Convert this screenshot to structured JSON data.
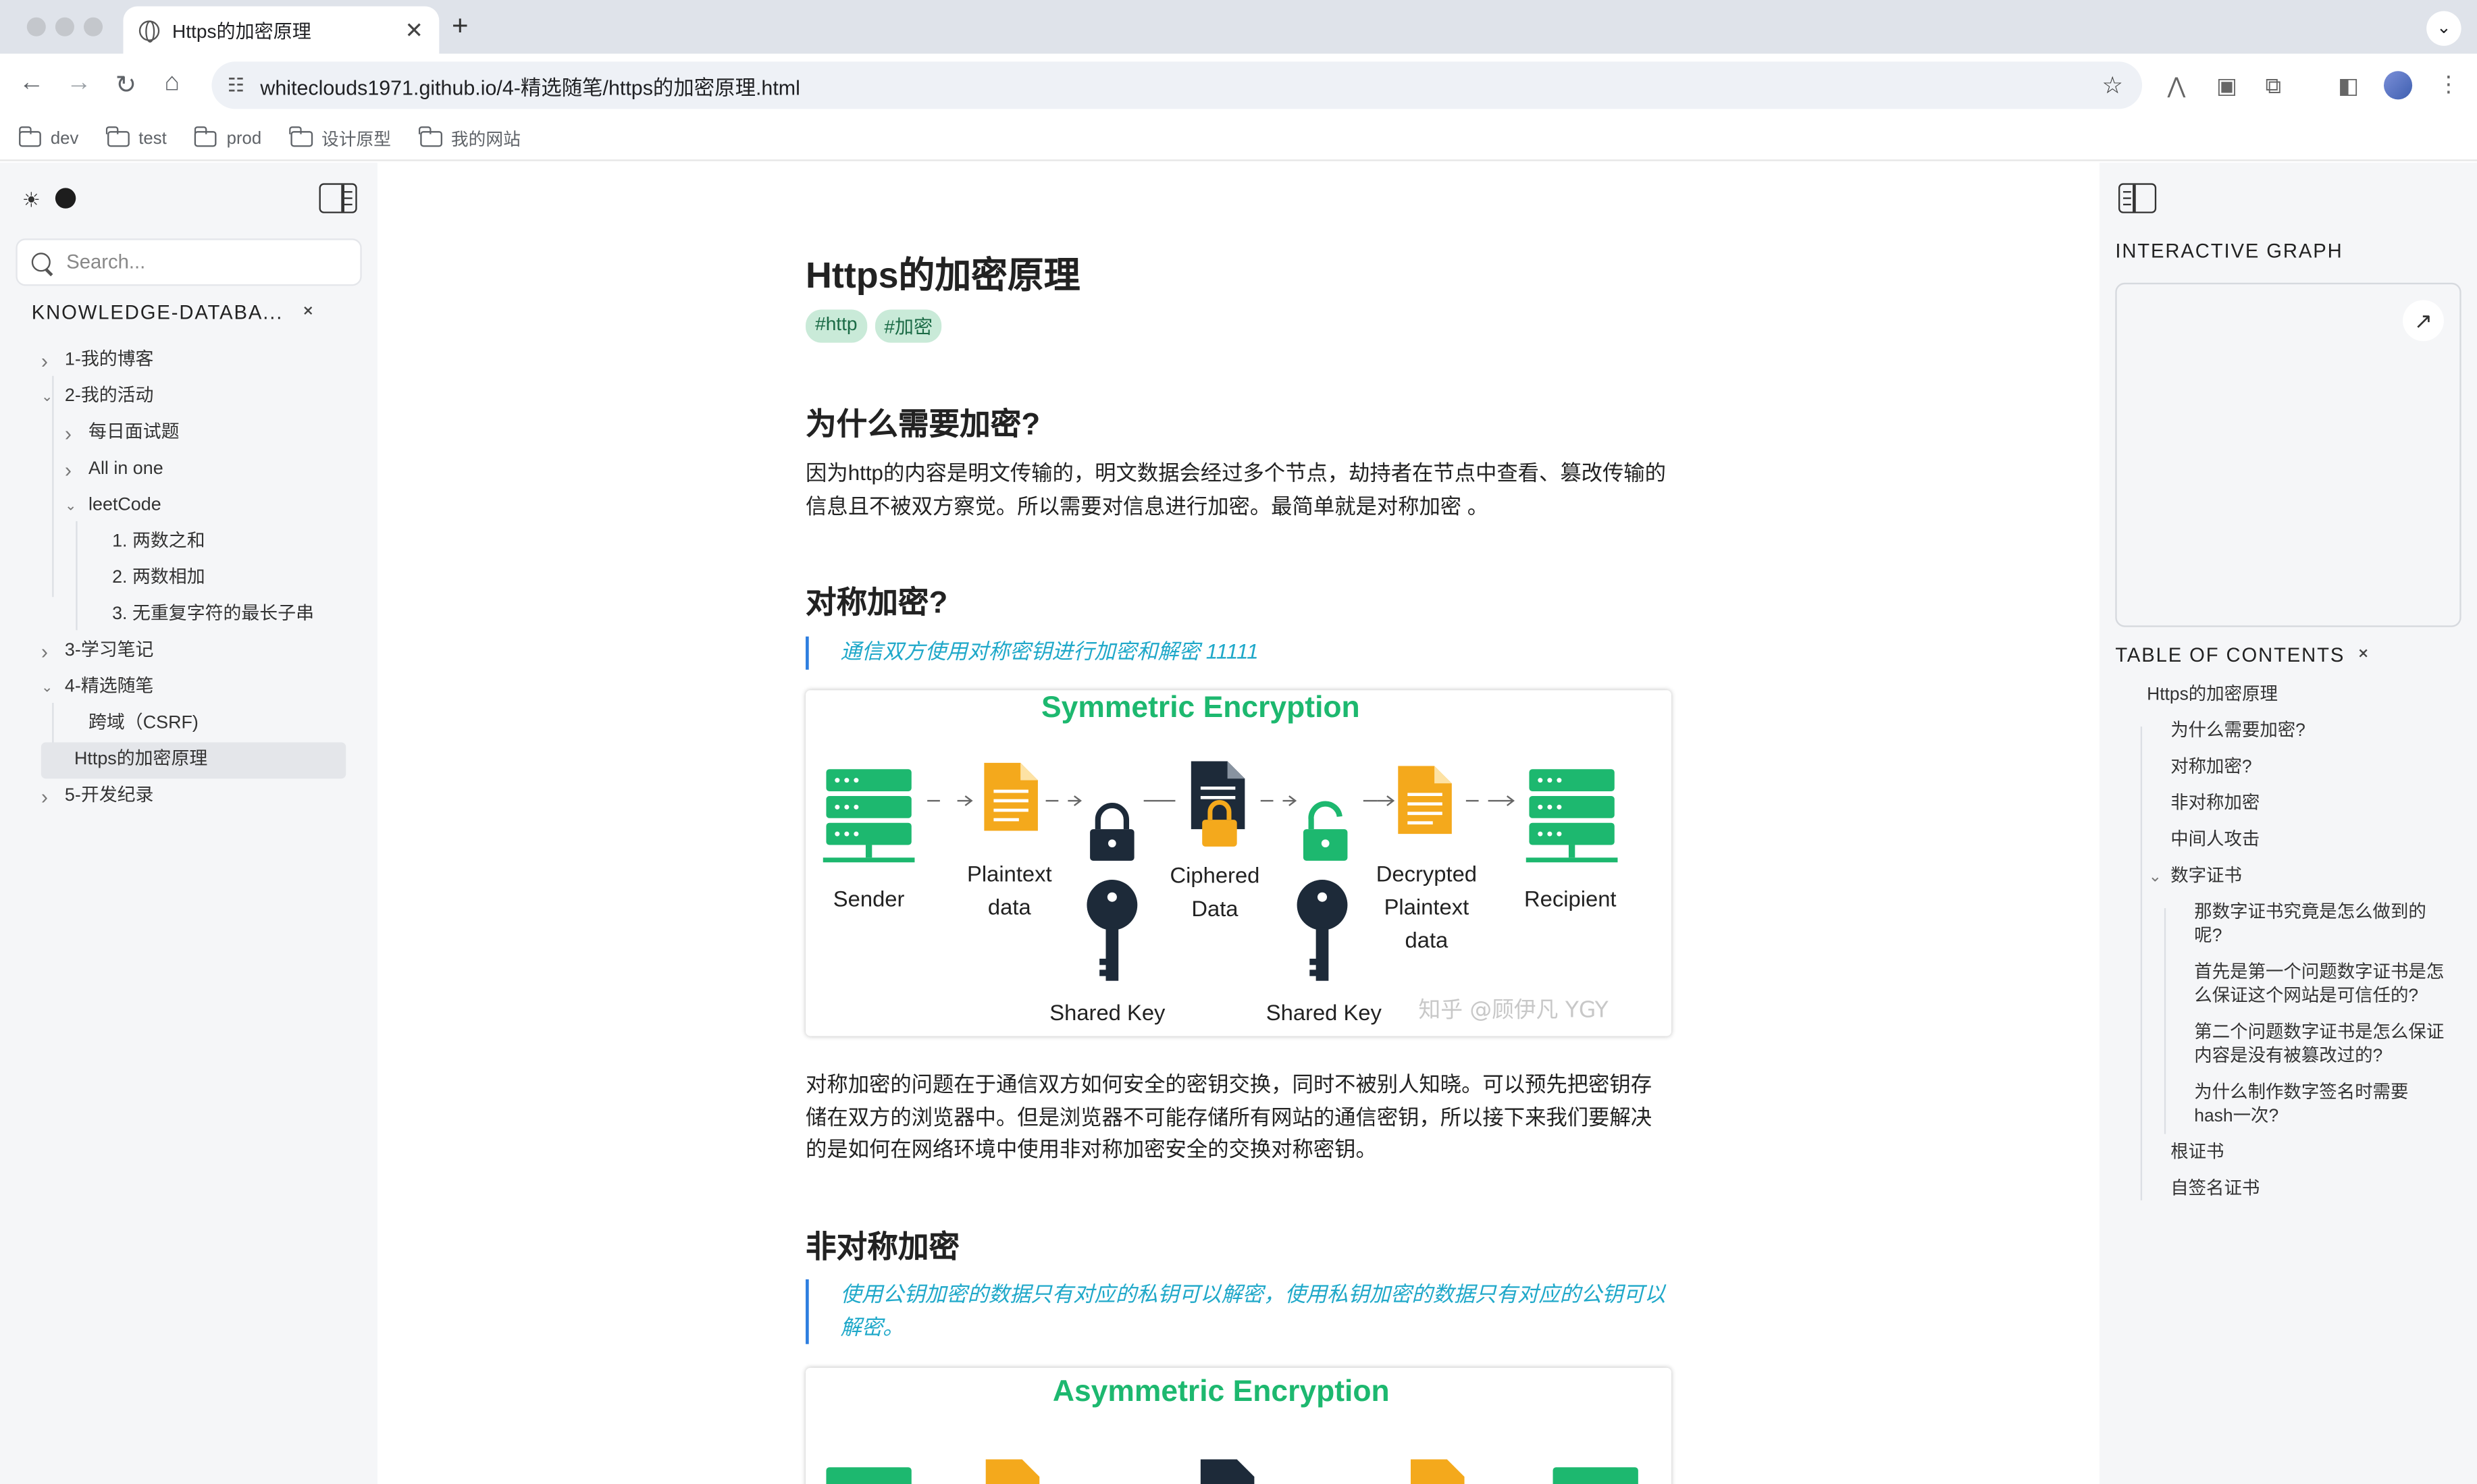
{
  "browser": {
    "tab_title": "Https的加密原理",
    "url": "whiteclouds1971.github.io/4-精选随笔/https的加密原理.html",
    "bookmarks": [
      "dev",
      "test",
      "prod",
      "设计原型",
      "我的网站"
    ]
  },
  "sidebar": {
    "search_placeholder": "Search...",
    "root_title": "KNOWLEDGE-DATABA...",
    "tree": [
      {
        "label": "1-我的博客",
        "level": 0,
        "expanded": false
      },
      {
        "label": "2-我的活动",
        "level": 0,
        "expanded": true
      },
      {
        "label": "每日面试题",
        "level": 1,
        "expanded": false
      },
      {
        "label": "All in one",
        "level": 1,
        "expanded": false
      },
      {
        "label": "leetCode",
        "level": 1,
        "expanded": true
      },
      {
        "label": "1. 两数之和",
        "level": 2
      },
      {
        "label": "2. 两数相加",
        "level": 2
      },
      {
        "label": "3. 无重复字符的最长子串",
        "level": 2
      },
      {
        "label": "3-学习笔记",
        "level": 0,
        "expanded": false
      },
      {
        "label": "4-精选随笔",
        "level": 0,
        "expanded": true
      },
      {
        "label": "跨域（CSRF)",
        "level": 1
      },
      {
        "label": "Https的加密原理",
        "level": 1,
        "active": true
      },
      {
        "label": "5-开发纪录",
        "level": 0,
        "expanded": false
      }
    ]
  },
  "article": {
    "title": "Https的加密原理",
    "tags": [
      "#http",
      "#加密"
    ],
    "h_why": "为什么需要加密?",
    "p_why": "因为http的内容是明文传输的，明文数据会经过多个节点，劫持者在节点中查看、篡改传输的信息且不被双方察觉。所以需要对信息进行加密。最简单就是对称加密 。",
    "h_sym": "对称加密?",
    "q_sym": "通信双方使用对称密钥进行加密和解密 11111",
    "p_sym": "对称加密的问题在于通信双方如何安全的密钥交换，同时不被别人知晓。可以预先把密钥存储在双方的浏览器中。但是浏览器不可能存储所有网站的通信密钥，所以接下来我们要解决的是如何在网络环境中使用非对称加密安全的交换对称密钥。",
    "h_asym": "非对称加密",
    "q_asym": "使用公钥加密的数据只有对应的私钥可以解密，使用私钥加密的数据只有对应的公钥可以解密。",
    "fig_sym": {
      "title": "Symmetric Encryption",
      "sender": "Sender",
      "plaintext": [
        "Plaintext",
        "data"
      ],
      "ciphered": [
        "Ciphered",
        "Data"
      ],
      "decrypted": [
        "Decrypted",
        "Plaintext",
        "data"
      ],
      "recipient": "Recipient",
      "shared_key": "Shared Key",
      "watermark": "知乎 @顾伊凡 YGY"
    },
    "fig_asym": {
      "title": "Asymmetric Encryption"
    }
  },
  "right": {
    "graph_label": "INTERACTIVE GRAPH",
    "toc_label": "TABLE OF CONTENTS",
    "toc": [
      {
        "label": "Https的加密原理",
        "level": 0
      },
      {
        "label": "为什么需要加密?",
        "level": 1
      },
      {
        "label": "对称加密?",
        "level": 1
      },
      {
        "label": "非对称加密",
        "level": 1
      },
      {
        "label": "中间人攻击",
        "level": 1
      },
      {
        "label": "数字证书",
        "level": 1,
        "expanded": true
      },
      {
        "label": "那数字证书究竟是怎么做到的呢?",
        "level": 2
      },
      {
        "label": "首先是第一个问题数字证书是怎么保证这个网站是可信任的?",
        "level": 2
      },
      {
        "label": "第二个问题数字证书是怎么保证内容是没有被篡改过的?",
        "level": 2
      },
      {
        "label": "为什么制作数字签名时需要hash一次?",
        "level": 2
      },
      {
        "label": "根证书",
        "level": 1
      },
      {
        "label": "自签名证书",
        "level": 1
      }
    ]
  },
  "colors": {
    "accent_green": "#1db86f",
    "tag_bg": "#c9ead8",
    "quote_text": "#1fa8c9",
    "quote_border": "#2d7ee0",
    "doc_orange": "#f4a91c",
    "dark": "#1d2a39"
  }
}
